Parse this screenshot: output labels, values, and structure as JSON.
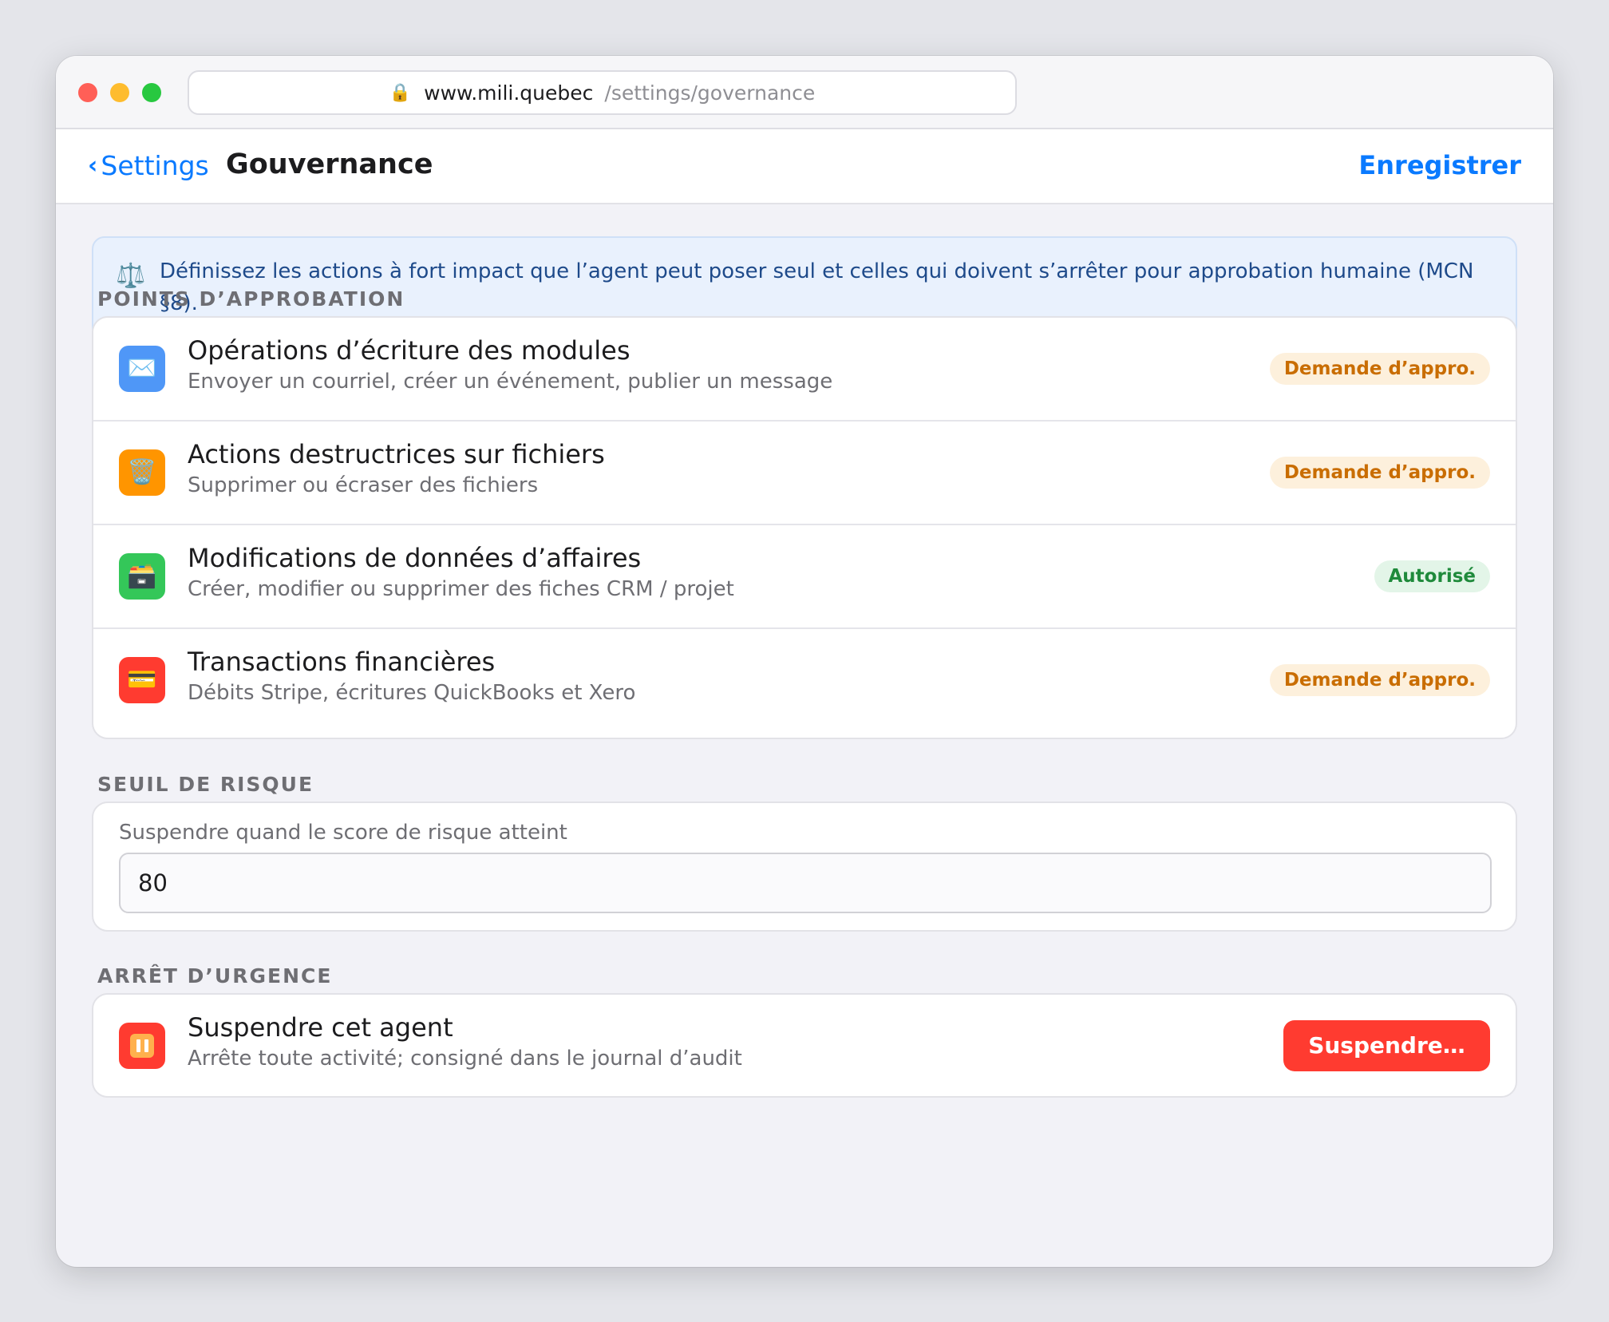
{
  "browser": {
    "lock_icon": "🔒",
    "host": "www.mili.quebec",
    "path": "/settings/governance"
  },
  "navbar": {
    "back_label": "Settings",
    "title": "Gouvernance",
    "save_label": "Enregistrer"
  },
  "info": {
    "icon": "⚖️",
    "text": "Définissez les actions à fort impact que l’agent peut poser seul et celles qui doivent s’arrêter pour approbation humaine (MCN §8)."
  },
  "approval": {
    "section_title": "POINTS D’APPROBATION",
    "rows": [
      {
        "icon": "✉️",
        "icon_name": "envelope-icon",
        "icon_color": "#4f97f7",
        "title": "Opérations d’écriture des modules",
        "subtitle": "Envoyer un courriel, créer un événement, publier un message",
        "status": "Demande d’appro.",
        "status_kind": "pending"
      },
      {
        "icon": "🗑️",
        "icon_name": "trash-icon",
        "icon_color": "#ff9500",
        "title": "Actions destructrices sur fichiers",
        "subtitle": "Supprimer ou écraser des fichiers",
        "status": "Demande d’appro.",
        "status_kind": "pending"
      },
      {
        "icon": "🗃️",
        "icon_name": "file-cabinet-icon",
        "icon_color": "#34c759",
        "title": "Modifications de données d’affaires",
        "subtitle": "Créer, modifier ou supprimer des fiches CRM / projet",
        "status": "Autorisé",
        "status_kind": "allowed"
      },
      {
        "icon": "💳",
        "icon_name": "credit-card-icon",
        "icon_color": "#ff3b30",
        "title": "Transactions financières",
        "subtitle": "Débits Stripe, écritures QuickBooks et Xero",
        "status": "Demande d’appro.",
        "status_kind": "pending"
      }
    ]
  },
  "risk": {
    "section_title": "SEUIL DE RISQUE",
    "field_label": "Suspendre quand le score de risque atteint",
    "value": "80"
  },
  "emergency": {
    "section_title": "ARRÊT D’URGENCE",
    "icon_color": "#ff3b30",
    "title": "Suspendre cet agent",
    "subtitle": "Arrête toute activité; consigné dans le journal d’audit",
    "button_label": "Suspendre…"
  }
}
